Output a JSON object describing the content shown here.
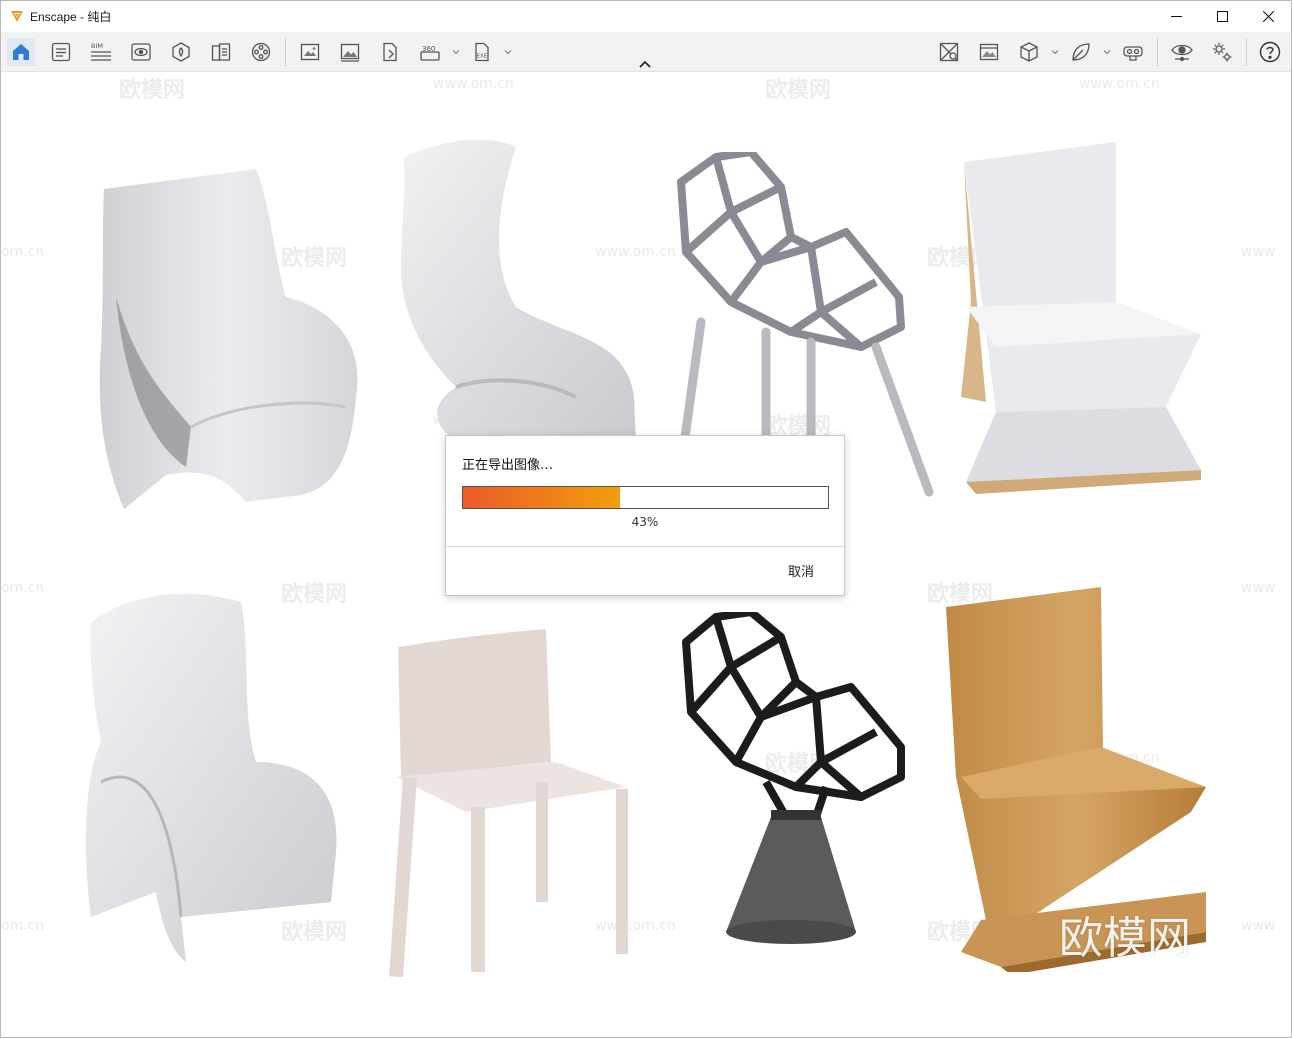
{
  "window": {
    "title": "Enscape - 纯白",
    "controls": [
      "minimize-icon",
      "maximize-icon",
      "close-icon"
    ]
  },
  "toolbar": {
    "left_tools": [
      "home-icon",
      "views-list-icon",
      "bim-icon",
      "visual-settings-icon",
      "assets-icon",
      "library-icon",
      "video-icon",
      "screenshot-icon",
      "image-export-icon",
      "render-icon",
      "panorama-360-icon",
      "exe-export-icon"
    ],
    "bim_label": "BIM",
    "panorama_label": "360",
    "exe_label": "EXE",
    "right_tools": [
      "material-icon",
      "image-settings-icon",
      "cube-icon",
      "leaf-icon",
      "vr-icon",
      "eye-icon",
      "settings-icon",
      "help-icon"
    ],
    "active_tool": "home-icon",
    "accent_color": "#2d7cd6"
  },
  "viewport": {
    "watermark_text": "欧模网",
    "watermark_url": "www.om.cn",
    "watermark_url_partial": "om.cn",
    "watermark_url_prefix": "www",
    "watermark_big": "欧模网"
  },
  "dialog": {
    "title": "正在导出图像…",
    "progress_percent": 43,
    "progress_label": "43%",
    "cancel_label": "取消",
    "progress_gradient": [
      "#ec5a2a",
      "#f29e0c"
    ]
  }
}
